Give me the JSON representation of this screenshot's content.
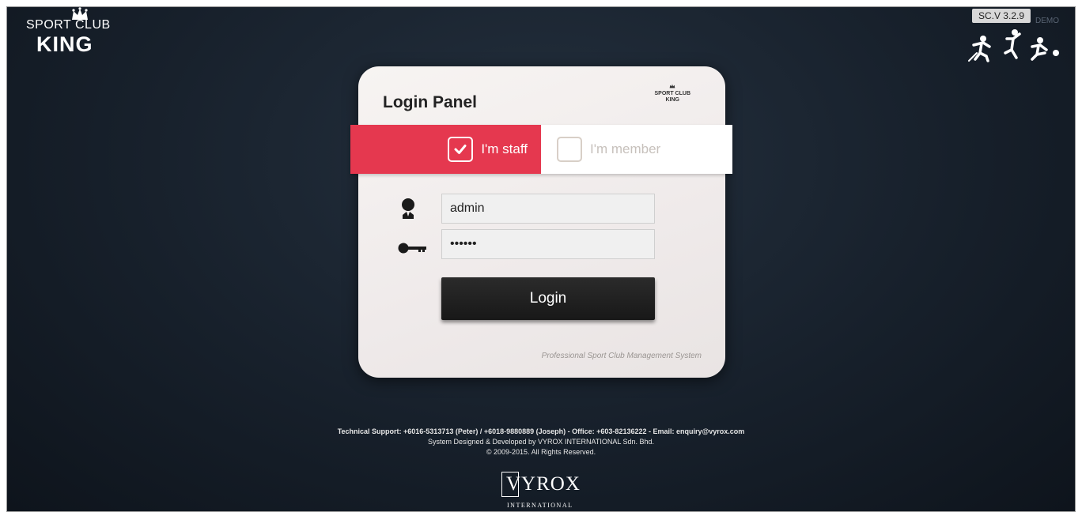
{
  "brand": {
    "line1": "SPORT CLUB",
    "line2": "KING"
  },
  "version": {
    "label": "SC.V 3.2.9",
    "demo": "DEMO"
  },
  "login": {
    "title": "Login Panel",
    "logo_top": "SPORT CLUB",
    "logo_bottom": "KING",
    "roles": {
      "staff": "I'm staff",
      "member": "I'm member",
      "selected": "staff"
    },
    "username_value": "admin",
    "password_value": "123456",
    "button_label": "Login",
    "tagline": "Professional Sport Club Management System"
  },
  "footer": {
    "support": "Technical Support: +6016-5313713 (Peter) / +6018-9880889 (Joseph) - Office: +603-82136222 - Email: enquiry@vyrox.com",
    "designed": "System Designed & Developed by VYROX INTERNATIONAL Sdn. Bhd.",
    "copyright": "© 2009-2015. All Rights Reserved.",
    "company_word": "VYROX",
    "company_sub": "INTERNATIONAL"
  },
  "colors": {
    "accent": "#e5384f",
    "background": "#17202b",
    "card": "#f2eeed",
    "button": "#1f1f1f"
  },
  "icons": {
    "user": "user-icon",
    "key": "key-icon",
    "checkmark": "checkmark-icon",
    "crown": "crown-icon",
    "sports": "sports-figures-icon"
  }
}
